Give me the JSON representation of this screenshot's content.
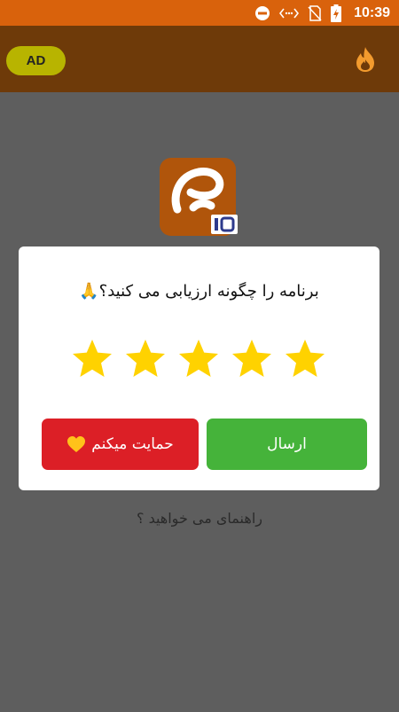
{
  "status_bar": {
    "time": "10:39",
    "icons": [
      "do-not-disturb-icon",
      "data-transfer-icon",
      "no-sim-icon",
      "battery-charging-icon"
    ]
  },
  "app_bar": {
    "ad_label": "AD",
    "icons": [
      "flame-icon"
    ]
  },
  "dialog": {
    "question": "برنامه را چگونه ارزیابی می کنید؟🙏",
    "rating": {
      "value": 5,
      "max": 5
    },
    "send_label": "ارسال",
    "support_label": "حمایت میکنم",
    "support_icon": "heart-icon"
  },
  "help_link": "راهنمای می خواهید ؟",
  "colors": {
    "status_bar": "#d9620c",
    "app_bar": "#6e3a09",
    "ad_badge": "#b8b400",
    "send_button": "#45b33a",
    "support_button": "#dc1f26",
    "star": "#ffd200",
    "logo": "#b0550b"
  }
}
